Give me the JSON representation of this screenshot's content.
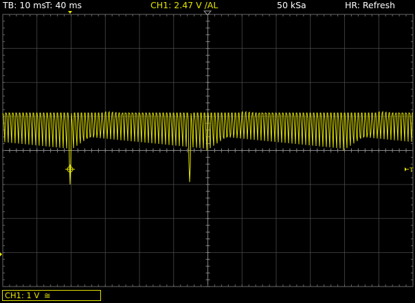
{
  "status_bar": {
    "timebase": "TB: 10 ms",
    "trigger_time": "T: 40 ms",
    "channel_trigger": "CH1: 2.47 V ∕AL",
    "sample_rate": "50 kSa",
    "mode": "HR: Refresh"
  },
  "channel_info": {
    "label": "CH1: 1 V",
    "coupling_symbol": "≅"
  },
  "markers": {
    "trigger_level_label": "T"
  },
  "colors": {
    "channel1": "#e6e600",
    "grid": "#4a4a4a",
    "text": "#ffffff",
    "background": "#000000"
  },
  "waveform": {
    "description_type": "sawtooth pulse train",
    "period_ms": 1.0,
    "high_level_div": 1.1,
    "low_level_div": 0.05,
    "glitch_times_ms": [
      0,
      35
    ],
    "glitch_depth_div": -1.0
  }
}
